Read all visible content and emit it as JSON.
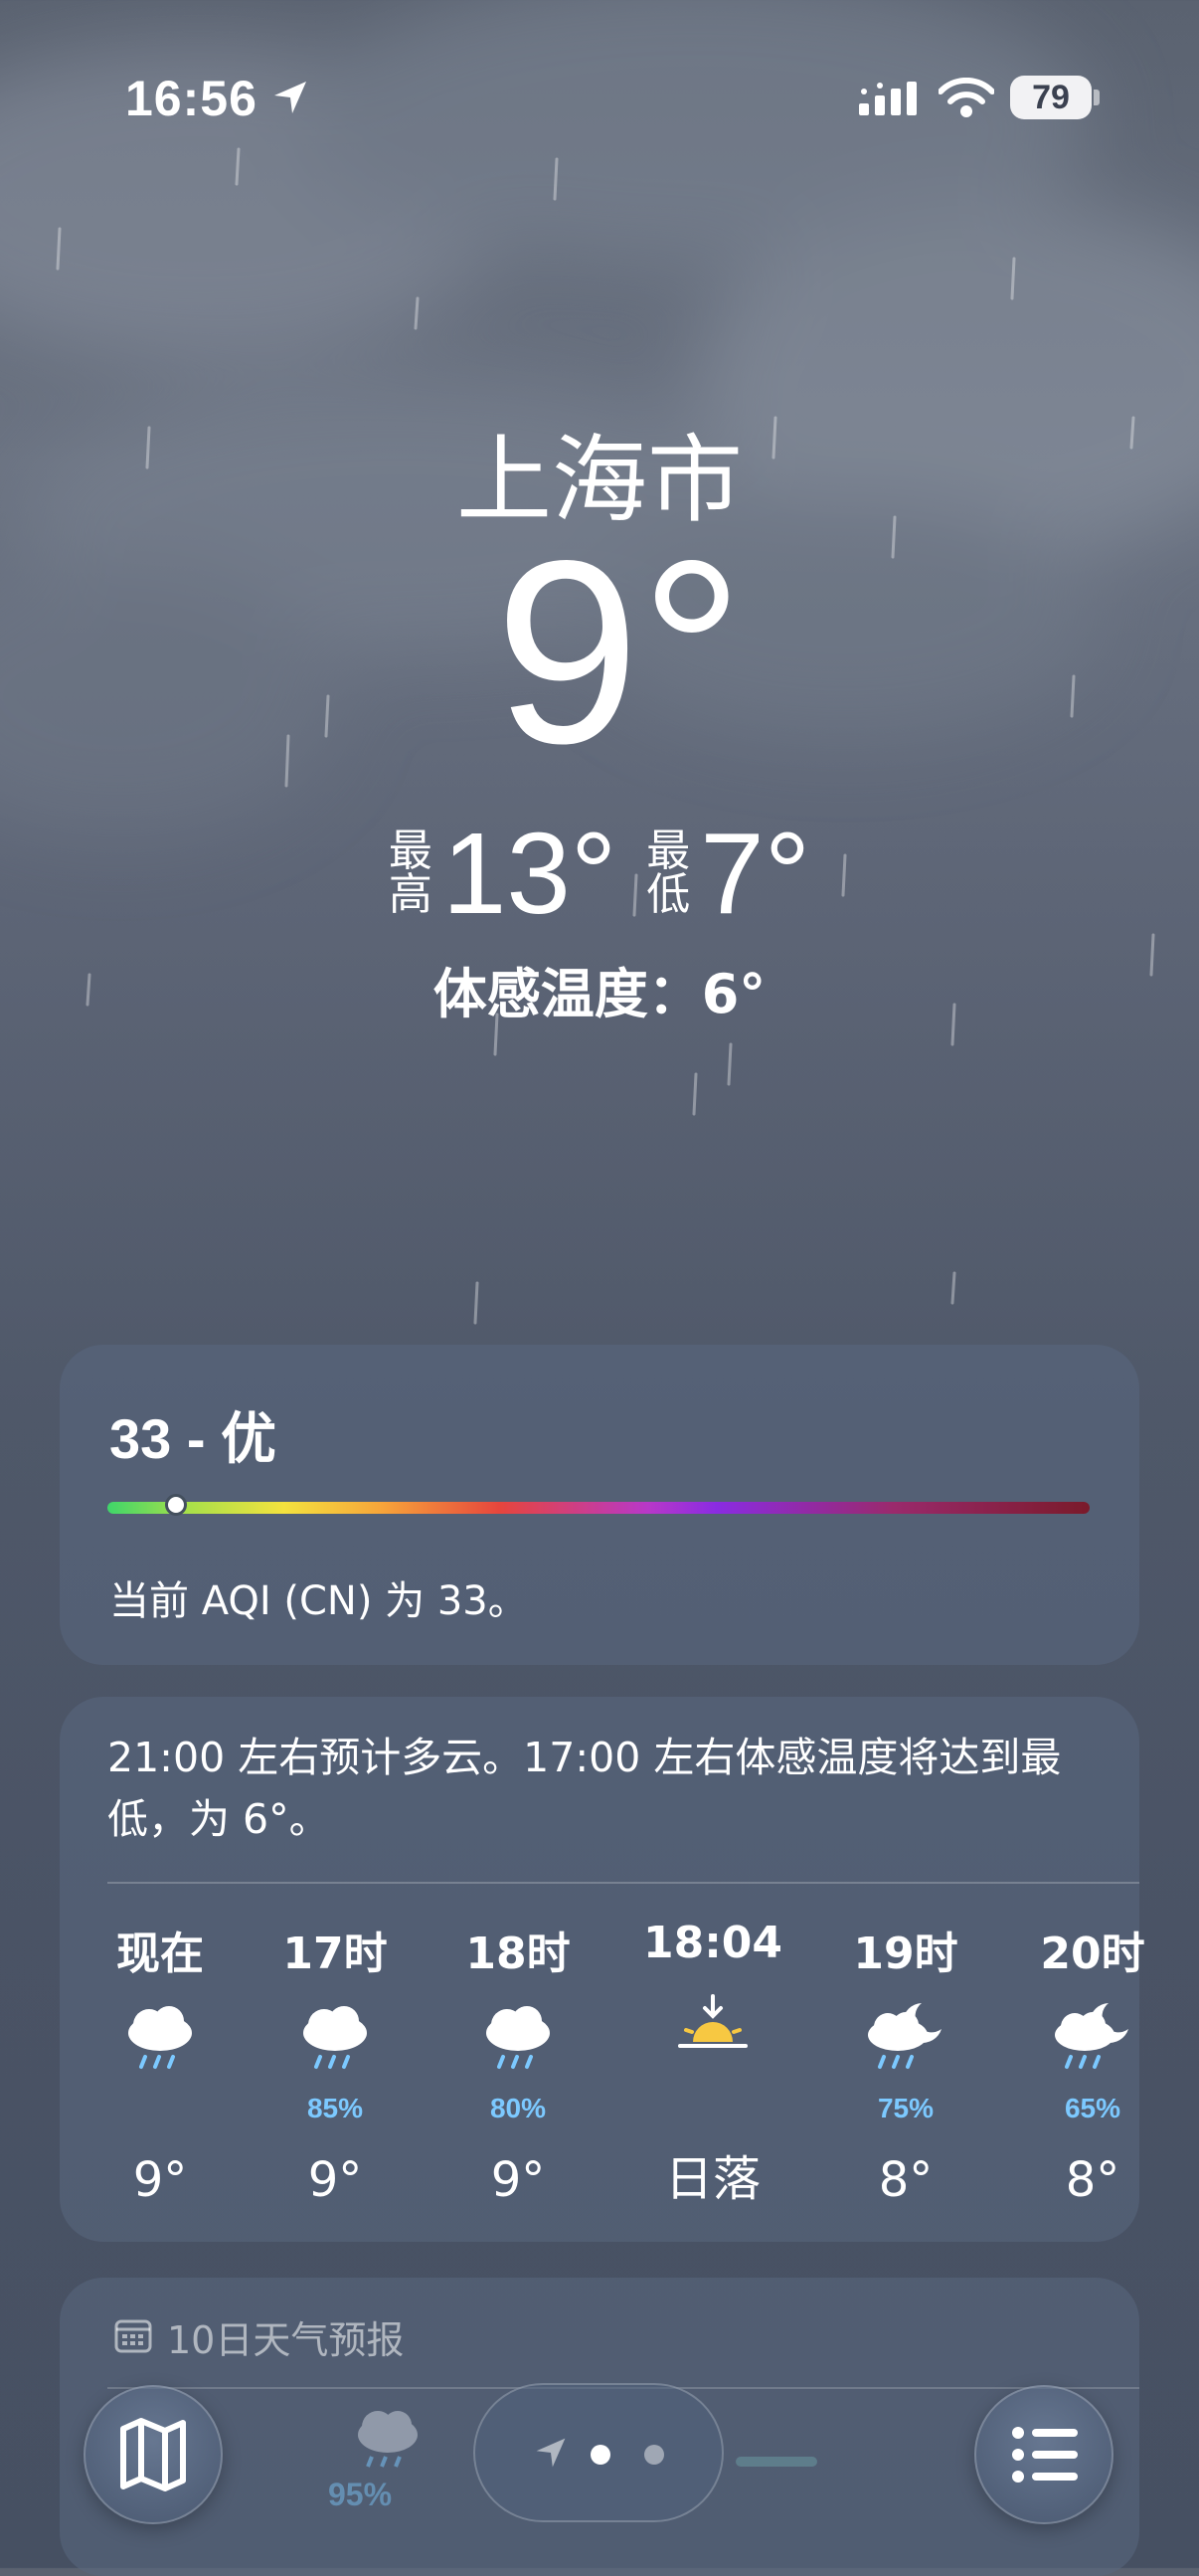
{
  "status": {
    "time": "16:56",
    "battery": "79"
  },
  "hero": {
    "city": "上海市",
    "temp": "9°",
    "high_label": "最高",
    "high": "13°",
    "low_label": "最低",
    "low": "7°",
    "feels_like": "体感温度：6°"
  },
  "aqi": {
    "title": "33 - 优",
    "level": 0.07,
    "text": "当前 AQI (CN) 为 33。"
  },
  "hourly": {
    "summary": "21:00 左右预计多云。17:00 左右体感温度将达到最低，为 6°。",
    "items": [
      {
        "time": "现在",
        "icon": "rain-cloud-icon",
        "pop": "",
        "value": "9°"
      },
      {
        "time": "17时",
        "icon": "rain-cloud-icon",
        "pop": "85%",
        "value": "9°"
      },
      {
        "time": "18时",
        "icon": "rain-cloud-icon",
        "pop": "80%",
        "value": "9°"
      },
      {
        "time": "18:04",
        "icon": "sunset-icon",
        "pop": "",
        "value": "日落"
      },
      {
        "time": "19时",
        "icon": "rain-moon-cloud-icon",
        "pop": "75%",
        "value": "8°"
      },
      {
        "time": "20时",
        "icon": "rain-moon-cloud-icon",
        "pop": "65%",
        "value": "8°"
      }
    ]
  },
  "forecast": {
    "title": "10日天气预报",
    "icon": "calendar-icon"
  },
  "toolbar": {
    "ghost_pop": "95%"
  },
  "colors": {
    "pop": "#7cc9ff",
    "sun": "#f7c842",
    "card": "#5a6880"
  }
}
